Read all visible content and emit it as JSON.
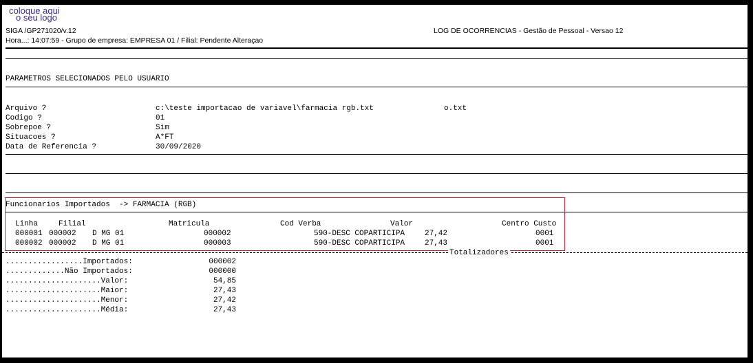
{
  "logo": {
    "line1": "coloque aqui",
    "line2": "o seu logo"
  },
  "header": {
    "program": "SIGA /GP271020/v.12",
    "title": "LOG DE OCORRENCIAS - Gestão de Pessoal - Versao 12",
    "info": "Hora...: 14:07:59 - Grupo de empresa: EMPRESA 01 / Filial: Pendente Alteraçao"
  },
  "params": {
    "section_title": "PARAMETROS SELECIONADOS PELO USUARIO",
    "rows": [
      {
        "label": "Arquivo ?",
        "value": "c:\\teste importacao de variavel\\farmacia rgb.txt",
        "extra": "o.txt"
      },
      {
        "label": "Codigo ?",
        "value": "01"
      },
      {
        "label": "Sobrepoe ?",
        "value": "Sim"
      },
      {
        "label": "Situacoes ?",
        "value": "A*FT"
      },
      {
        "label": "Data de Referencia ?",
        "value": "30/09/2020"
      }
    ]
  },
  "imported": {
    "title": "Funcionarios Importados  -> FARMACIA (RGB)",
    "headers": {
      "linha": "Linha",
      "filial": "Filial",
      "matricula": "Matricula",
      "cod_verba": "Cod Verba",
      "valor": "Valor",
      "centro_custo": "Centro Custo"
    },
    "rows": [
      {
        "linha": "000001",
        "filial": "000002",
        "desc": "D MG 01",
        "matricula": "000002",
        "verba": "590-DESC COPARTICIPA",
        "valor": "27,42",
        "centro": "0001"
      },
      {
        "linha": "000002",
        "filial": "000002",
        "desc": "D MG 01",
        "matricula": "000003",
        "verba": "590-DESC COPARTICIPA",
        "valor": "27,43",
        "centro": "0001"
      }
    ]
  },
  "totals": {
    "title": "Totalizadores",
    "rows": [
      {
        "label": ".................Importados:",
        "value": "000002"
      },
      {
        "label": ".............Não Importados:",
        "value": "000000"
      },
      {
        "label": ".....................Valor:",
        "value": "54,85"
      },
      {
        "label": ".....................Maior:",
        "value": "27,43"
      },
      {
        "label": ".....................Menor:",
        "value": "27,42"
      },
      {
        "label": ".....................Média:",
        "value": "27,43"
      }
    ]
  }
}
